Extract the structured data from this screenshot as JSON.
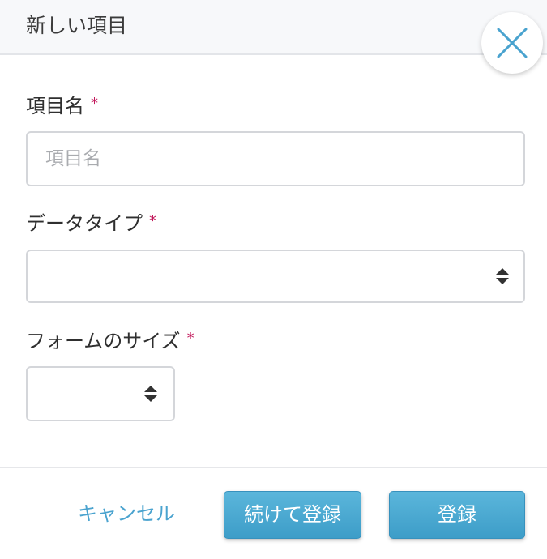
{
  "header": {
    "title": "新しい項目"
  },
  "form": {
    "item_name": {
      "label": "項目名",
      "required_mark": "*",
      "placeholder": "項目名",
      "value": ""
    },
    "data_type": {
      "label": "データタイプ",
      "required_mark": "*",
      "selected": ""
    },
    "form_size": {
      "label": "フォームのサイズ",
      "required_mark": "*",
      "selected": ""
    }
  },
  "footer": {
    "cancel_label": "キャンセル",
    "continue_register_label": "続けて登録",
    "register_label": "登録"
  },
  "colors": {
    "accent": "#4aa3cf",
    "button": "#45a6d0",
    "required": "#c2185b",
    "close_icon": "#4aa3cf"
  },
  "icons": {
    "close": "close-icon",
    "select_arrows": "sort-arrows-icon"
  }
}
